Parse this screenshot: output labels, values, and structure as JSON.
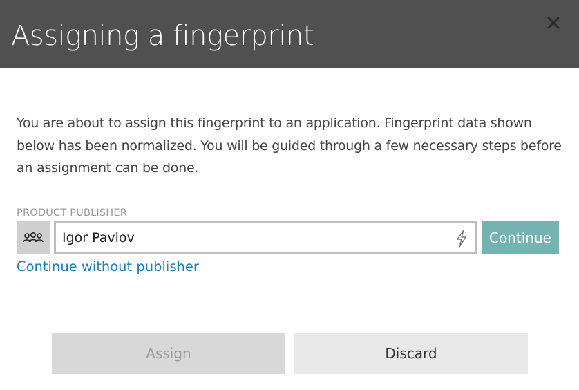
{
  "dialog": {
    "title": "Assigning a fingerprint",
    "close_icon": "close-icon",
    "description": "You are about to assign this fingerprint to an application. Fingerprint data shown below has been normalized. You will be guided through a few necessary steps before an assignment can be done.",
    "publisher": {
      "label": "PRODUCT PUBLISHER",
      "icon": "users-group-icon",
      "value": "Igor Pavlov",
      "action_icon": "lightning-icon",
      "continue_label": "Continue"
    },
    "continue_without_label": "Continue without publisher",
    "footer": {
      "assign_label": "Assign",
      "assign_enabled": false,
      "discard_label": "Discard"
    },
    "colors": {
      "header_bg": "#505050",
      "accent_button": "#74b3b1",
      "link": "#1a7fc0"
    }
  }
}
